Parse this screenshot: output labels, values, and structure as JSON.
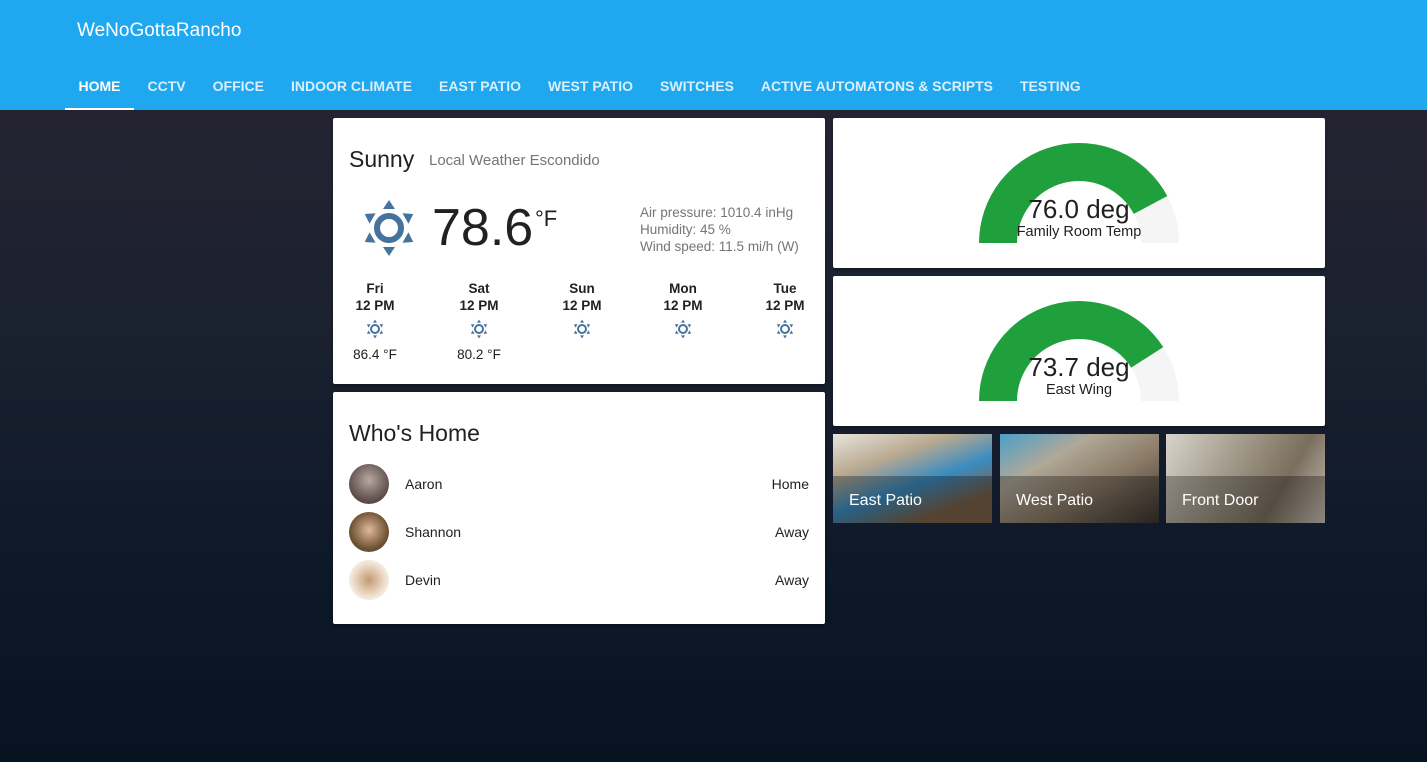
{
  "header": {
    "title": "WeNoGottaRancho",
    "tabs": [
      "HOME",
      "CCTV",
      "OFFICE",
      "INDOOR CLIMATE",
      "EAST PATIO",
      "WEST PATIO",
      "SWITCHES",
      "ACTIVE AUTOMATONS & SCRIPTS",
      "TESTING"
    ],
    "active_tab": "HOME"
  },
  "weather": {
    "condition": "Sunny",
    "name": "Local Weather Escondido",
    "temperature": "78.6",
    "unit": "°F",
    "attributes": [
      "Air pressure: 1010.4 inHg",
      "Humidity: 45 %",
      "Wind speed: 11.5 mi/h (W)"
    ],
    "forecast": [
      {
        "day": "Fri",
        "time": "12 PM",
        "temp": "86.4 °F"
      },
      {
        "day": "Sat",
        "time": "12 PM",
        "temp": "80.2 °F"
      },
      {
        "day": "Sun",
        "time": "12 PM"
      },
      {
        "day": "Mon",
        "time": "12 PM"
      },
      {
        "day": "Tue",
        "time": "12 PM"
      }
    ],
    "icon": "sunny-icon",
    "icon_color": "#44739e"
  },
  "who_home": {
    "title": "Who's Home",
    "people": [
      {
        "name": "Aaron",
        "state": "Home"
      },
      {
        "name": "Shannon",
        "state": "Away"
      },
      {
        "name": "Devin",
        "state": "Away"
      }
    ]
  },
  "gauges": [
    {
      "value_text": "76.0 deg",
      "label": "Family Room Temp",
      "value": 76.0,
      "min": 0,
      "max": 90
    },
    {
      "value_text": "73.7 deg",
      "label": "East Wing",
      "value": 73.7,
      "min": 0,
      "max": 90
    }
  ],
  "gauge_color": "#1fa03c",
  "cameras": [
    {
      "label": "East Patio"
    },
    {
      "label": "West Patio"
    },
    {
      "label": "Front Door"
    }
  ]
}
